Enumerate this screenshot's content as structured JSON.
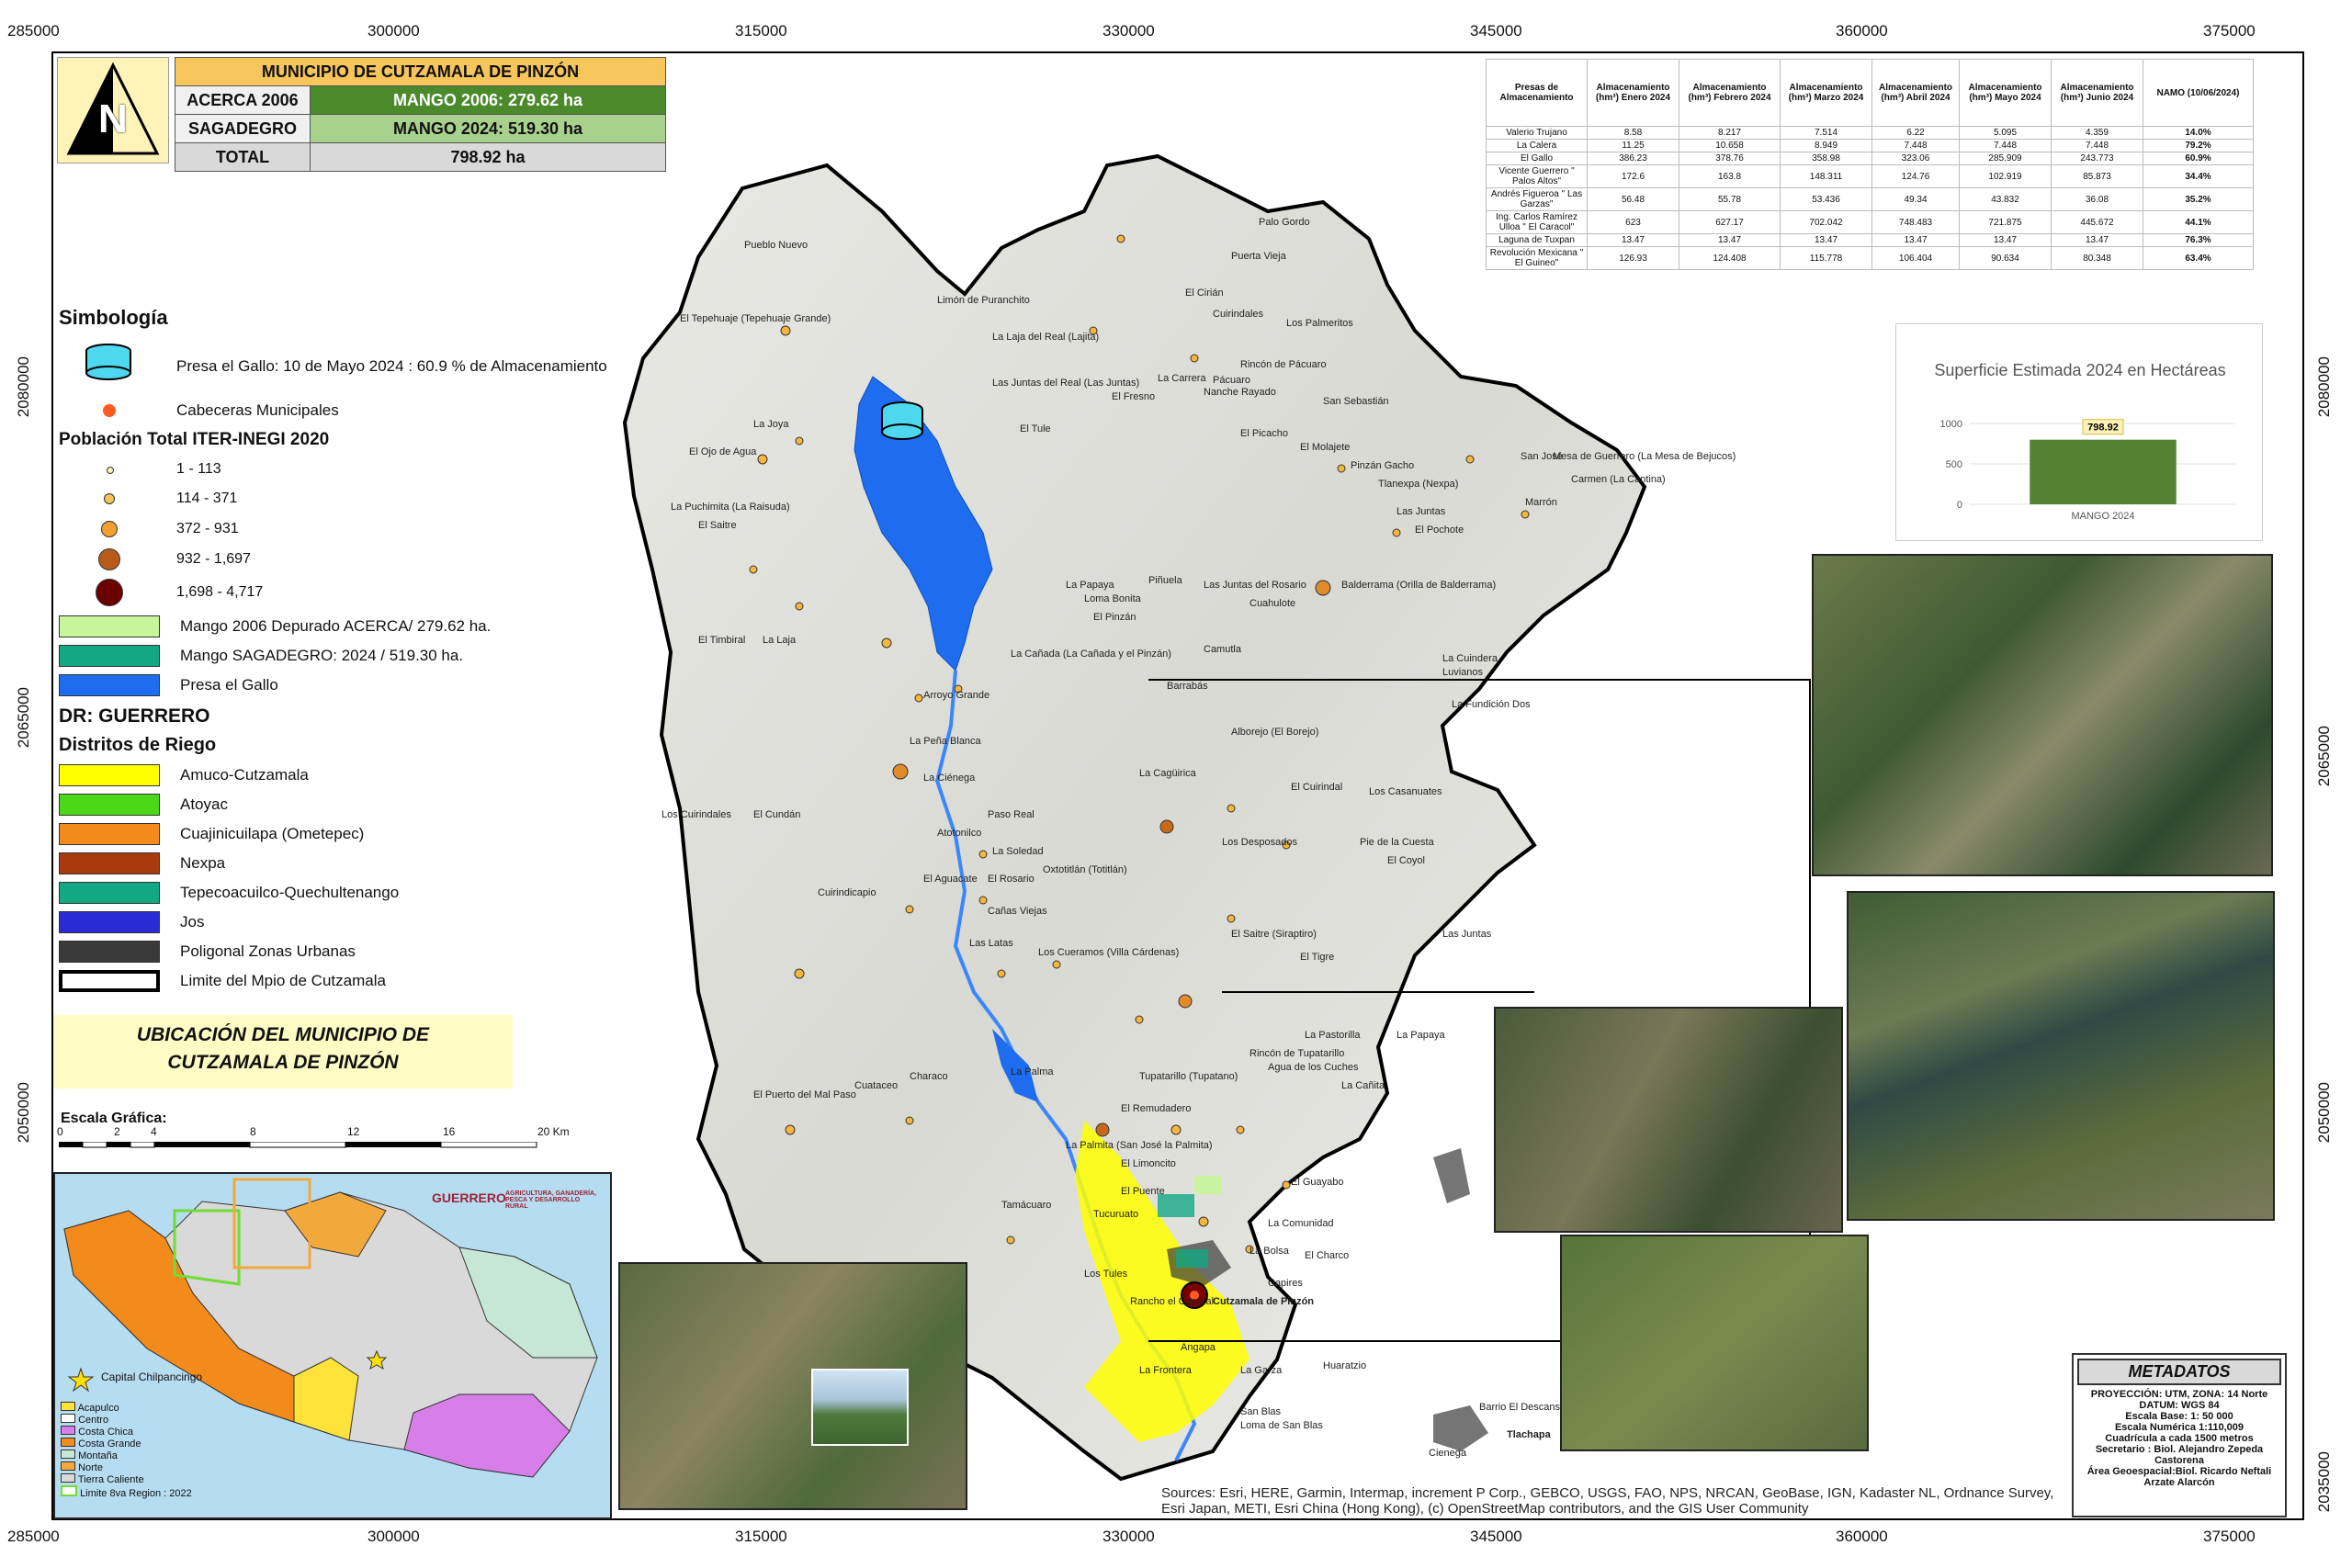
{
  "frame": {
    "top_coords": [
      "285000",
      "300000",
      "315000",
      "330000",
      "345000",
      "360000",
      "375000"
    ],
    "bottom_coords": [
      "285000",
      "300000",
      "315000",
      "330000",
      "345000",
      "360000",
      "375000"
    ],
    "left_coords": [
      "2080000",
      "2065000",
      "2050000"
    ],
    "right_coords": [
      "2080000",
      "2065000",
      "2050000",
      "2035000"
    ]
  },
  "summary": {
    "title": "MUNICIPIO DE CUTZAMALA DE PINZÓN",
    "row1_label": "ACERCA 2006",
    "row1_value": "MANGO 2006: 279.62 ha",
    "row2_label": "SAGADEGRO",
    "row2_value": "MANGO 2024: 519.30 ha",
    "row3_label": "TOTAL",
    "row3_value": "798.92 ha"
  },
  "north_arrow": "N",
  "legend": {
    "title": "Simbología",
    "presa_label": "Presa el Gallo: 10 de Mayo 2024 : 60.9 % de Almacenamiento",
    "cabeceras_label": "Cabeceras Municipales",
    "poblacion_title": "Población Total ITER-INEGI 2020",
    "poblacion_items": [
      "1 - 113",
      "114 - 371",
      "372 - 931",
      "932 - 1,697",
      "1,698 - 4,717"
    ],
    "mango2006": "Mango 2006 Depurado ACERCA/  279.62 ha.",
    "mango2024": "Mango SAGADEGRO: 2024 /  519.30 ha.",
    "presa_gallo": "Presa el Gallo",
    "dr_title": "DR: GUERRERO",
    "distritos_title": "Distritos de Riego",
    "distritos": [
      {
        "label": "Amuco-Cutzamala",
        "color": "#ffff00"
      },
      {
        "label": "Atoyac",
        "color": "#4cd817"
      },
      {
        "label": "Cuajinicuilapa (Ometepec)",
        "color": "#f28a1c"
      },
      {
        "label": "Nexpa",
        "color": "#a83a0f"
      },
      {
        "label": "Tepecoacuilco-Quechultenango",
        "color": "#12a882"
      },
      {
        "label": "Jos",
        "color": "#2b2bd6"
      },
      {
        "label": "Poligonal Zonas Urbanas",
        "color": "#3a3a3a"
      },
      {
        "label": "Limite del Mpio de Cutzamala",
        "color": "#ffffff"
      }
    ]
  },
  "ubicacion": {
    "line1": "UBICACIÓN DEL MUNICIPIO DE",
    "line2": "CUTZAMALA DE PINZÓN"
  },
  "scale": {
    "title": "Escala Gráfica:",
    "ticks": [
      "0",
      "2",
      "4",
      "8",
      "12",
      "16",
      "20 Km"
    ]
  },
  "inset_map": {
    "capital_label": "Capital Chilpancingo",
    "regions": [
      "Acapulco",
      "Centro",
      "Costa Chica",
      "Costa Grande",
      "Montaña",
      "Norte",
      "Tierra Caliente",
      "Limite 8va Region : 2022"
    ],
    "gov_text1": "GUERRERO",
    "gov_text2": "AGRICULTURA, GANADERÍA, PESCA Y DESARROLLO RURAL"
  },
  "reservoir_table": {
    "headers": [
      "Presas de Almacenamiento",
      "Almacenamiento (hm³) Enero 2024",
      "Almacenamiento (hm³) Febrero 2024",
      "Almacenamiento (hm³) Marzo 2024",
      "Almacenamiento (hm³) Abril 2024",
      "Almacenamiento (hm³) Mayo 2024",
      "Almacenamiento (hm³) Junio 2024",
      "NAMO (10/06/2024)"
    ],
    "rows": [
      [
        "Valerio Trujano",
        "8.58",
        "8.217",
        "7.514",
        "6.22",
        "5.095",
        "4.359",
        "14.0%"
      ],
      [
        "La Calera",
        "11.25",
        "10.658",
        "8.949",
        "7.448",
        "7.448",
        "7.448",
        "79.2%"
      ],
      [
        "El Gallo",
        "386.23",
        "378.76",
        "358.98",
        "323.06",
        "285.909",
        "243.773",
        "60.9%"
      ],
      [
        "Vicente Guerrero \" Palos Altos\"",
        "172.6",
        "163.8",
        "148.311",
        "124.76",
        "102.919",
        "85.873",
        "34.4%"
      ],
      [
        "Andrés Figueroa \" Las Garzas\"",
        "56.48",
        "55.78",
        "53.436",
        "49.34",
        "43.832",
        "36.08",
        "35.2%"
      ],
      [
        "Ing. Carlos Ramírez Ulloa \" El Caracol\"",
        "623",
        "627.17",
        "702.042",
        "748.483",
        "721.875",
        "445.672",
        "44.1%"
      ],
      [
        "Laguna de Tuxpan",
        "13.47",
        "13.47",
        "13.47",
        "13.47",
        "13.47",
        "13.47",
        "76.3%"
      ],
      [
        "Revolución Mexicana \" El Guineo\"",
        "126.93",
        "124.408",
        "115.778",
        "106.404",
        "90.634",
        "80.348",
        "63.4%"
      ]
    ]
  },
  "chart_data": {
    "type": "bar",
    "title": "Superficie Estimada 2024 en Hectáreas",
    "categories": [
      "MANGO 2024"
    ],
    "values": [
      798.92
    ],
    "ylim": [
      0,
      1000
    ],
    "yticks": [
      "1000",
      "500",
      "0"
    ],
    "data_label": "798.92",
    "bar_color": "#548235"
  },
  "places": [
    {
      "name": "Pueblo Nuevo"
    },
    {
      "name": "Palo Gordo"
    },
    {
      "name": "El Tepehuaje (Tepehuaje Grande)"
    },
    {
      "name": "La Joya"
    },
    {
      "name": "El Ojo de Agua"
    },
    {
      "name": "La Puchimita (La Raisuda)"
    },
    {
      "name": "El Saitre"
    },
    {
      "name": "El Timbiral"
    },
    {
      "name": "La Laja"
    },
    {
      "name": "Arroyo Grande"
    },
    {
      "name": "La Peña Blanca"
    },
    {
      "name": "La Ciénega"
    },
    {
      "name": "Los Cuirindales"
    },
    {
      "name": "El Cundán"
    },
    {
      "name": "Paso Real"
    },
    {
      "name": "Atotonilco"
    },
    {
      "name": "El Aguacate"
    },
    {
      "name": "El Rosario"
    },
    {
      "name": "Cuirindicapio"
    },
    {
      "name": "Las Juntas del Real (Las Juntas)"
    },
    {
      "name": "La Carrera"
    },
    {
      "name": "El Fresno"
    },
    {
      "name": "Rincón de Pácuaro"
    },
    {
      "name": "Pácuaro"
    },
    {
      "name": "Nanche Rayado"
    },
    {
      "name": "San Sebastián"
    },
    {
      "name": "El Picacho"
    },
    {
      "name": "El Molajete"
    },
    {
      "name": "Pinzán Gacho"
    },
    {
      "name": "Tlanexpa (Nexpa)"
    },
    {
      "name": "Las Juntas"
    },
    {
      "name": "El Pochote"
    },
    {
      "name": "San José"
    },
    {
      "name": "Mesa de Guerrero (La Mesa de Bejucos)"
    },
    {
      "name": "Carmen (La Cantina)"
    },
    {
      "name": "Marrón"
    },
    {
      "name": "La Papaya"
    },
    {
      "name": "Piñuela"
    },
    {
      "name": "Loma Bonita"
    },
    {
      "name": "El Pinzán"
    },
    {
      "name": "Las Juntas del Rosario"
    },
    {
      "name": "Cuahulote"
    },
    {
      "name": "Balderrama (Orilla de Balderrama)"
    },
    {
      "name": "La Cuindera"
    },
    {
      "name": "Luvianos"
    },
    {
      "name": "La Fundición Dos"
    },
    {
      "name": "Barrabás"
    },
    {
      "name": "Camutla"
    },
    {
      "name": "Alborejo (El Borejo)"
    },
    {
      "name": "La Cagüirica"
    },
    {
      "name": "El Cuirindal"
    },
    {
      "name": "Los Casanuates"
    },
    {
      "name": "Los Desposados"
    },
    {
      "name": "Pie de la Cuesta"
    },
    {
      "name": "El Coyol"
    },
    {
      "name": "El Saitre (Siraptiro)"
    },
    {
      "name": "El Tigre"
    },
    {
      "name": "Las Juntas"
    },
    {
      "name": "Oxtotitlán (Totitlán)"
    },
    {
      "name": "Los Cueramos (Villa Cárdenas)"
    },
    {
      "name": "La Pastorilla"
    },
    {
      "name": "La Papaya"
    },
    {
      "name": "Rincón de Tupatarillo"
    },
    {
      "name": "Agua de los Cuches"
    },
    {
      "name": "La Cañita"
    },
    {
      "name": "Tupatarillo (Tupatano)"
    },
    {
      "name": "Cuataceo"
    },
    {
      "name": "Characo"
    },
    {
      "name": "El Puerto del Mal Paso"
    },
    {
      "name": "Tamácuaro"
    },
    {
      "name": "Tucuruato"
    },
    {
      "name": "La Comunidad"
    },
    {
      "name": "El Guayabo"
    },
    {
      "name": "El Charco"
    },
    {
      "name": "La Bolsa"
    },
    {
      "name": "Cutzamala de Pinzón"
    },
    {
      "name": "Capires"
    },
    {
      "name": "Los Tules"
    },
    {
      "name": "Rancho el Caporal"
    },
    {
      "name": "Angapa"
    },
    {
      "name": "La Frontera"
    },
    {
      "name": "La Garza"
    },
    {
      "name": "Huaratzio"
    },
    {
      "name": "San Blas"
    },
    {
      "name": "Loma de San Blas"
    },
    {
      "name": "Tlachapa"
    },
    {
      "name": "Barrio El Descanso"
    },
    {
      "name": "Cienega"
    },
    {
      "name": "Limón de Puranchito"
    },
    {
      "name": "La Laja del Real (Lajita)"
    },
    {
      "name": "Cuirindales"
    },
    {
      "name": "El Cirián"
    },
    {
      "name": "Puerta Vieja"
    },
    {
      "name": "Los Palmeritos"
    },
    {
      "name": "El Tule"
    },
    {
      "name": "La Cañada (La Cañada y el Pinzán)"
    },
    {
      "name": "La Soledad"
    },
    {
      "name": "Las Latas"
    },
    {
      "name": "Cañas Viejas"
    },
    {
      "name": "La Palma"
    },
    {
      "name": "La Palmita (San José la Palmita)"
    },
    {
      "name": "El Remudadero"
    },
    {
      "name": "El Limoncito"
    },
    {
      "name": "El Puente"
    }
  ],
  "credits": "Sources: Esri, HERE, Garmin, Intermap, increment P Corp., GEBCO, USGS, FAO, NPS, NRCAN, GeoBase, IGN, Kadaster NL, Ordnance Survey, Esri Japan, METI, Esri China (Hong Kong), (c) OpenStreetMap contributors, and the GIS User Community",
  "metadata": {
    "title": "METADATOS",
    "lines": [
      "PROYECCIÓN: UTM, ZONA: 14 Norte",
      "DATUM: WGS 84",
      "Escala Base: 1: 50 000",
      "Escala Numérica 1:110,009",
      "Cuadrícula a cada 1500 metros",
      "Secretario : Biol. Alejandro Zepeda Castorena",
      "Área Geoespacial:Biol. Ricardo Neftali Arzate Alarcón"
    ]
  }
}
